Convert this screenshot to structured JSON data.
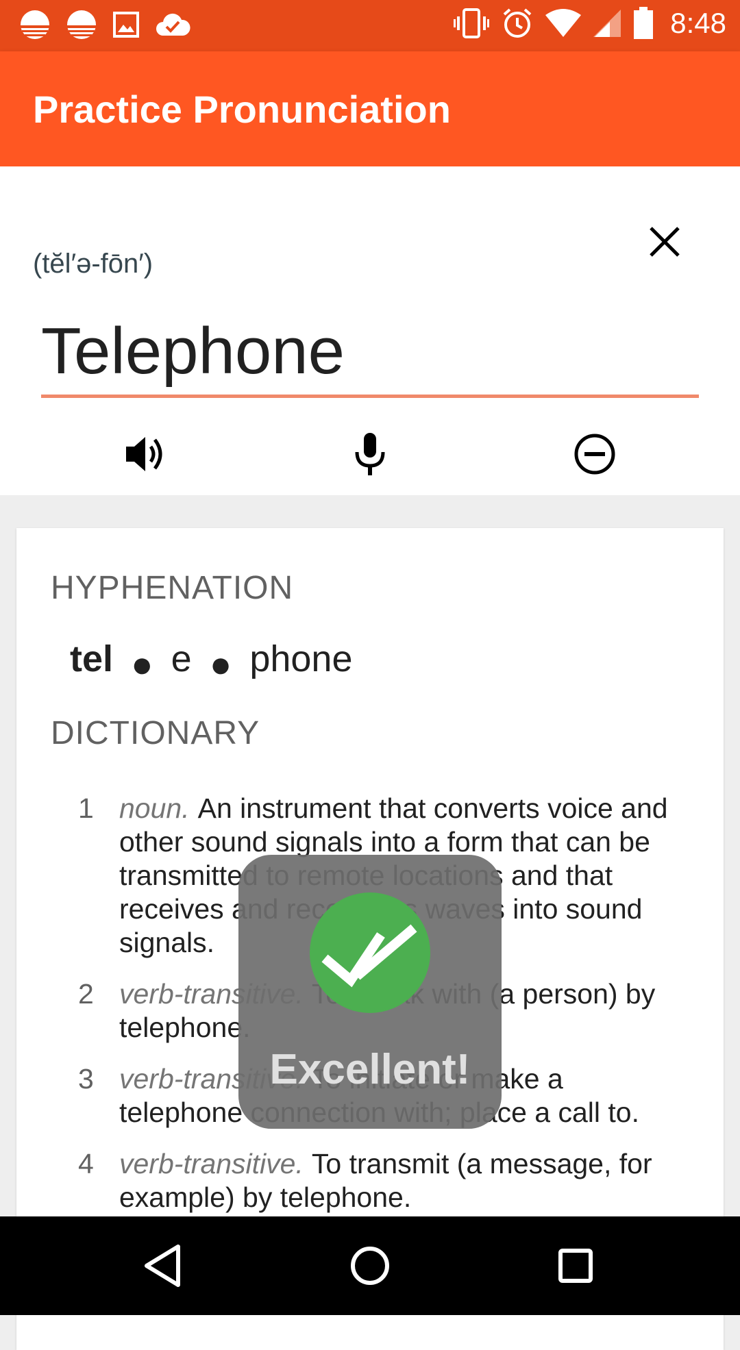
{
  "status_bar": {
    "time": "8:48",
    "left_icons": [
      "notification-icon",
      "notification-icon",
      "image-icon",
      "cloud-check-icon"
    ],
    "right_icons": [
      "vibrate-icon",
      "alarm-icon",
      "wifi-icon",
      "signal-icon",
      "battery-icon"
    ]
  },
  "app_bar": {
    "title": "Practice Pronunciation"
  },
  "word": {
    "phonetic": "(tĕl′ə-fōn′)",
    "value": "Telephone"
  },
  "hyphenation": {
    "label": "HYPHENATION",
    "syllables": [
      "tel",
      "e",
      "phone"
    ]
  },
  "dictionary": {
    "label": "DICTIONARY",
    "definitions": [
      {
        "num": "1",
        "pos": "noun.",
        "text": "An instrument that converts voice and other sound signals into a form that can be transmitted to remote locations and that receives and reconverts waves into sound signals."
      },
      {
        "num": "2",
        "pos": "verb-transitive.",
        "text": "To speak with (a person) by telephone."
      },
      {
        "num": "3",
        "pos": "verb-transitive.",
        "text": "To initiate or make a telephone connection with; place a call to."
      },
      {
        "num": "4",
        "pos": "verb-transitive.",
        "text": "To transmit (a message, for example) by telephone."
      }
    ]
  },
  "toast": {
    "message": "Excellent!"
  },
  "colors": {
    "status_bar": "#e64a19",
    "app_bar": "#ff5722",
    "accent_underline": "#f0896a",
    "success": "#4caf50"
  }
}
